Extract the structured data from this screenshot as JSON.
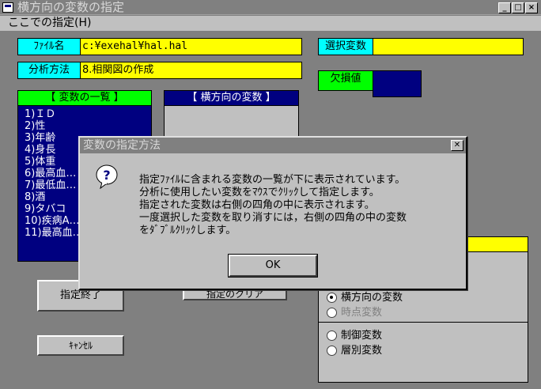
{
  "window": {
    "title": "横方向の変数の指定",
    "controls": [
      "_",
      "□",
      "×"
    ]
  },
  "menu": {
    "item": "ここでの指定(H)"
  },
  "form": {
    "file_label": "ﾌｧｲﾙ名",
    "file_value": "c:¥exehal¥hal.hal",
    "method_label": "分析方法",
    "method_value": "8.相関図の作成",
    "selected_var_label": "選択変数",
    "selected_var_value": "",
    "missing_label": "欠損値",
    "var_list_header": "【 変数の一覧 】",
    "var_list_items": [
      "1)ＩＤ",
      "2)性",
      "3)年齢",
      "4)身長",
      "5)体重",
      "6)最高血…",
      "7)最低血…",
      "8)酒",
      "9)タバコ",
      "10)疾病A…",
      "11)最高血…"
    ],
    "horiz_var_header": "【 横方向の変数 】",
    "finish_button": "指定終了",
    "clear_button": "指定のクリア",
    "cancel_button": "ｷｬﾝｾﾙ",
    "radio_group1": [
      {
        "label": "横方向の変数",
        "checked": true,
        "enabled": true
      },
      {
        "label": "時点変数",
        "checked": false,
        "enabled": false
      }
    ],
    "radio_group2": [
      {
        "label": "制御変数",
        "checked": false,
        "enabled": true
      },
      {
        "label": "層別変数",
        "checked": false,
        "enabled": true
      }
    ]
  },
  "dialog": {
    "title": "変数の指定方法",
    "message_lines": [
      "指定ﾌｧｲﾙに含まれる変数の一覧が下に表示されています。",
      "分析に使用したい変数をﾏｳｽでｸﾘｯｸして指定します。",
      "指定された変数は右側の四角の中に表示されます。",
      "一度選択した変数を取り消すには，右側の四角の中の変数",
      "をﾀﾞﾌﾞﾙｸﾘｯｸします。"
    ],
    "ok_button": "OK",
    "icon": "question-icon"
  },
  "colors": {
    "cyan": "#00ffff",
    "yellow": "#ffff00",
    "green": "#00ff00",
    "navy": "#000080",
    "face": "#c0c0c0",
    "desktop": "#808080"
  }
}
